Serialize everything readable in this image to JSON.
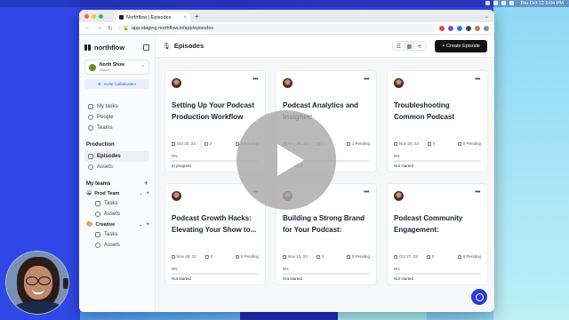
{
  "desktop": {
    "clock": "Thu Oct 12  5:04 PM"
  },
  "browser": {
    "tab_title": "Northflow | Episodes",
    "url": "app.staging.northflow.io/app/episodes"
  },
  "sidebar": {
    "logo": "northflow",
    "workspace": {
      "name": "North Show",
      "sub": "Owner"
    },
    "invite_label": "Invite Collaborator",
    "nav": [
      {
        "label": "My tasks"
      },
      {
        "label": "People"
      },
      {
        "label": "Teams"
      }
    ],
    "production_title": "Production",
    "production_items": [
      {
        "label": "Episodes"
      },
      {
        "label": "Assets"
      }
    ],
    "my_teams_title": "My teams",
    "teams": [
      {
        "name": "Prod Team",
        "emoji": "😀",
        "items": [
          "Tasks",
          "Assets"
        ]
      },
      {
        "name": "Creative",
        "emoji": "🎨",
        "items": [
          "Tasks",
          "Assets"
        ]
      }
    ]
  },
  "main": {
    "title": "Episodes",
    "create_label": "+ Create Episode"
  },
  "cards": [
    {
      "title": "Setting Up Your Podcast Production Workflow",
      "date": "Oct 20, 23",
      "tasks": "2",
      "pending": "0 Pending",
      "progress_pct": 0,
      "progress_label": "0%",
      "status": "In progress"
    },
    {
      "title": "Podcast Analytics and Insights: Understanding...",
      "date": "Nov 30, 23",
      "tasks": "1",
      "pending": "1 Pending",
      "progress_pct": 0,
      "progress_label": "0%",
      "status": "Not started"
    },
    {
      "title": "Troubleshooting Common Podcast Challenges: A...",
      "date": "Nov 24, 23",
      "tasks": "0",
      "pending": "0 Pending",
      "progress_pct": 0,
      "progress_label": "0%",
      "status": "Not started"
    },
    {
      "title": "Podcast Growth Hacks: Elevating Your Show to...",
      "date": "Nov 28, 23",
      "tasks": "0",
      "pending": "0 Pending",
      "progress_pct": 0,
      "progress_label": "0%",
      "status": "Not started"
    },
    {
      "title": "Building a Strong Brand for Your Podcast: Image,...",
      "date": "Nov 12, 23",
      "tasks": "0",
      "pending": "0 Pending",
      "progress_pct": 0,
      "progress_label": "0%",
      "status": "Not started"
    },
    {
      "title": "Podcast Community Engagement: Connectin...",
      "date": "Oct 27, 23",
      "tasks": "0",
      "pending": "0 Pending",
      "progress_pct": 0,
      "progress_label": "0%",
      "status": "Not started"
    }
  ],
  "colors": {
    "accent": "#3b5bdb",
    "button": "#111111",
    "chat": "#2b3bd6"
  }
}
